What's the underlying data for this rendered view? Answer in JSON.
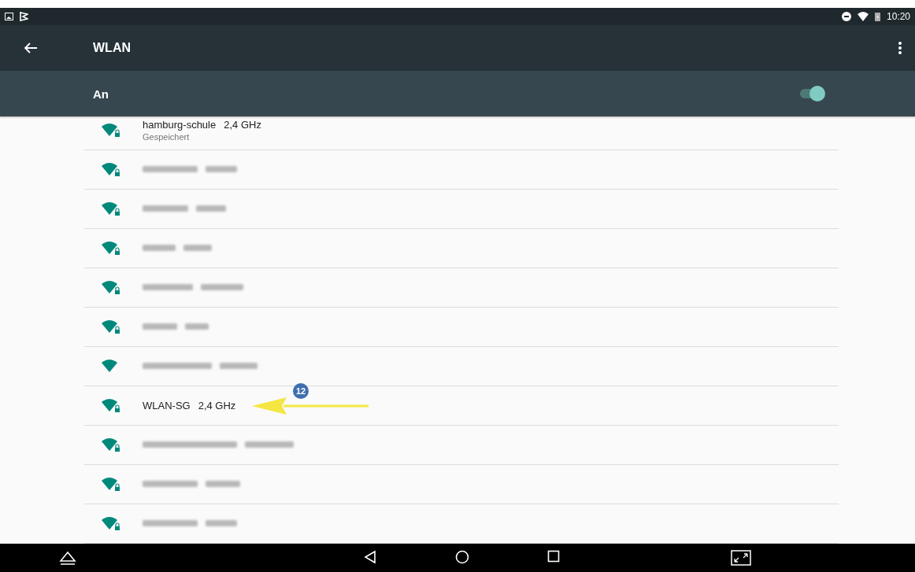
{
  "status_bar": {
    "time": "10:20"
  },
  "toolbar": {
    "title": "WLAN"
  },
  "master_switch": {
    "label": "An",
    "on": true
  },
  "networks": [
    {
      "kind": "named",
      "name": "hamburg-schule",
      "band": "2,4 GHz",
      "status": "Gespeichert",
      "locked": true
    },
    {
      "kind": "blurred",
      "locked": true
    },
    {
      "kind": "blurred",
      "locked": true
    },
    {
      "kind": "blurred",
      "locked": true
    },
    {
      "kind": "blurred",
      "locked": true
    },
    {
      "kind": "blurred",
      "locked": true
    },
    {
      "kind": "blurred",
      "locked": false
    },
    {
      "kind": "named",
      "name": "WLAN-SG",
      "band": "2,4 GHz",
      "locked": true,
      "annotation_badge": "12"
    },
    {
      "kind": "blurred",
      "locked": true
    },
    {
      "kind": "blurred",
      "locked": true
    },
    {
      "kind": "blurred",
      "locked": true
    }
  ]
}
